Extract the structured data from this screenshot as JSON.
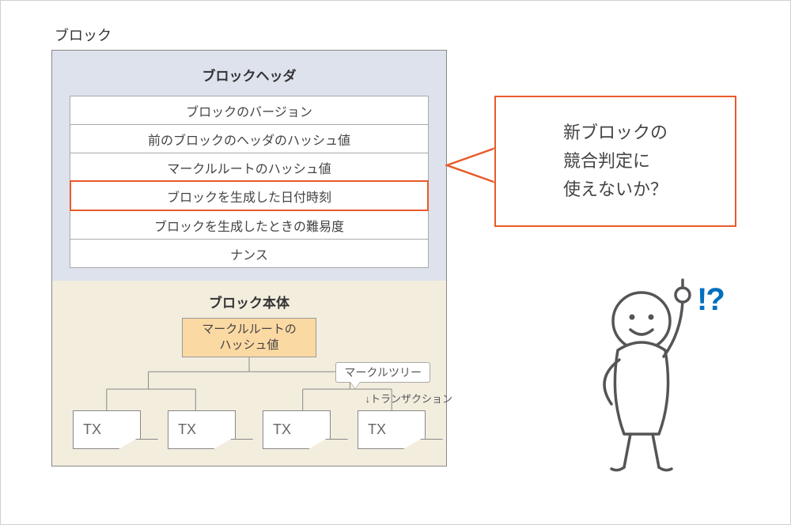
{
  "block": {
    "outer_title": "ブロック",
    "header": {
      "title": "ブロックヘッダ",
      "rows": [
        "ブロックのバージョン",
        "前のブロックのヘッダのハッシュ値",
        "マークルルートのハッシュ値",
        "ブロックを生成した日付時刻",
        "ブロックを生成したときの難易度",
        "ナンス"
      ],
      "highlight_index": 3
    },
    "body": {
      "title": "ブロック本体",
      "merkle_root": "マークルルートの\nハッシュ値",
      "merkle_tree_label": "マークルツリー",
      "transaction_label": "↓トランザクション",
      "tx_boxes": [
        "TX",
        "TX",
        "TX",
        "TX"
      ]
    }
  },
  "speech": {
    "text": "新ブロックの\n競合判定に\n使えないか？"
  },
  "exclaim": "!?",
  "colors": {
    "highlight": "#e85a2a",
    "header_bg": "#dee2ec",
    "body_bg": "#f3edde",
    "merkle_root_bg": "#fbd9a3",
    "exclaim": "#0070c0"
  }
}
